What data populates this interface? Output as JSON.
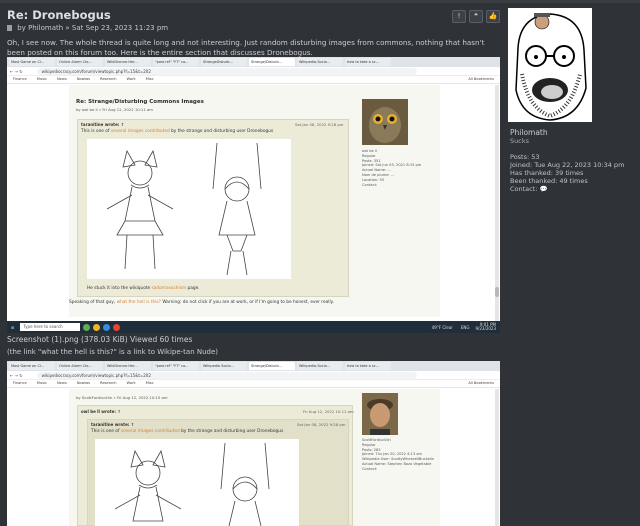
{
  "post": {
    "title": "Re: Dronebogus",
    "by_prefix": "by",
    "author": "Philomath",
    "date": "» Sat Sep 23, 2023 11:23 pm",
    "text": "Oh, I see now. The whole thread is quite long and not interesting. Just random disturbing images from commons, nothing that hasn't been posted on this forum too. Here is the entire section that discusses Dronebogus.",
    "buttons": [
      "!",
      "❝",
      "👍"
    ]
  },
  "profile": {
    "name": "Philomath",
    "rank": "Sucks",
    "stats": [
      "Posts: 53",
      "Joined: Tue Aug 22, 2023 10:34 pm",
      "Has thanked: 39 times",
      "Been thanked: 49 times",
      "Contact:"
    ]
  },
  "screenshot1": {
    "tabs": [
      "Most Game on Cl...",
      "Online Alarm Clo...",
      "WikiDronne-Her...",
      "\"post ref\" \"FT\" co...",
      "StrangeDisturb...",
      "Strange/Disturb...",
      "Wikipedia-Socia...",
      "how to take a sc..."
    ],
    "url": "wikipediocracy.com/forum/viewtopic.php?f=15&t=202",
    "bookmarks": [
      "Finance",
      "Music",
      "News",
      "Nowtas",
      "Research",
      "Work",
      "Misc",
      "All Bookmarks"
    ],
    "post_title": "Re: Strange/Disturbing Commons Images",
    "post_by": "by owl be ll » Fri Aug 12, 2022 10:11 am",
    "quote_author": "taranitine wrote: ↑",
    "quote_date": "Sat Jan 08, 2022 9:28 pm",
    "quote_text_pre": "This is one of ",
    "quote_link": "several images contributed",
    "quote_text_post": " by the strange and disturbing user Dronebogus",
    "stuck_pre": "He stuck it into the wikiquote ",
    "stuck_link": "sadomasochism",
    "stuck_post": " page.",
    "speaking_pre": "Speaking of that guy, ",
    "speaking_link": "what the hell is this?",
    "speaking_post": " Warning: do not click if you are at work, or if I'm going to be honest, ever really.",
    "side": [
      "owl be ll",
      "Regular",
      "",
      "Posts: 351",
      "Joined: Sat Jun 05, 2021 8:15 pm",
      "Actual Name: ...",
      "Nom de plume: ...",
      "Location: 55",
      "Contact:"
    ],
    "taskbar_search": "Type here to search",
    "weather": "49°F Clear",
    "time": "9:01 PM",
    "date": "9/23/2023",
    "lang": "ENG"
  },
  "captions": {
    "file": "Screenshot (1).png (378.03 KiB) Viewed 60 times",
    "note": "(the link \"what the hell is this?\" is a link to Wikipe-tan Nude)"
  },
  "screenshot2": {
    "tabs": [
      "Most Game on Cl...",
      "Online Alarm Clo...",
      "WikiDronne-Her...",
      "\"post ref\" \"FT\" co...",
      "Wikipedia Socio...",
      "Strange/Disturb...",
      "Wikipedia-Socia...",
      "how to take a sc..."
    ],
    "url": "wikipediocracy.com/forum/viewtopic.php?f=15&t=202",
    "bookmarks": [
      "Finance",
      "Music",
      "News",
      "Nowtas",
      "Research",
      "Work",
      "Misc",
      "All Bookmarks"
    ],
    "post_by": "by ScottFordlucklin » Fri Aug 12, 2022 10:15 am",
    "outer_author": "owl be ll wrote: ↑",
    "outer_date": "Fri Aug 12, 2022 10:11 am",
    "quote_author": "taranitine wrote: ↑",
    "quote_date": "Sat Jan 08, 2022 9:28 pm",
    "quote_text_pre": "This is one of ",
    "quote_link": "several images contributed",
    "quote_text_post": " by the strange and disturbing user Dronebogus",
    "side": [
      "ScottFordlucklin",
      "Regular",
      "",
      "Posts: 285",
      "Joined: Thu Jan 20, 2022 4:13 am",
      "Wikipedia User: ScottyWheezellBuckelin",
      "Actual Name: Stephen Bozo Vegetable",
      "Contact:"
    ]
  }
}
